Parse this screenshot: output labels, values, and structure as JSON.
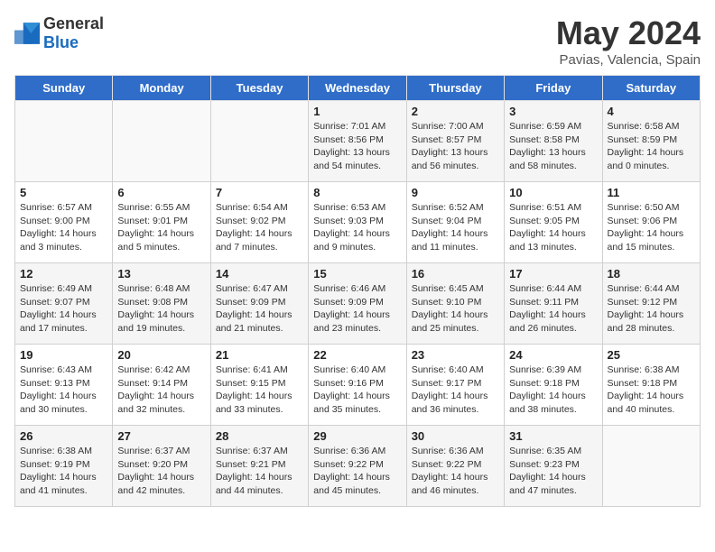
{
  "header": {
    "logo_general": "General",
    "logo_blue": "Blue",
    "title": "May 2024",
    "subtitle": "Pavias, Valencia, Spain"
  },
  "weekdays": [
    "Sunday",
    "Monday",
    "Tuesday",
    "Wednesday",
    "Thursday",
    "Friday",
    "Saturday"
  ],
  "weeks": [
    [
      {
        "day": "",
        "info": ""
      },
      {
        "day": "",
        "info": ""
      },
      {
        "day": "",
        "info": ""
      },
      {
        "day": "1",
        "info": "Sunrise: 7:01 AM\nSunset: 8:56 PM\nDaylight: 13 hours\nand 54 minutes."
      },
      {
        "day": "2",
        "info": "Sunrise: 7:00 AM\nSunset: 8:57 PM\nDaylight: 13 hours\nand 56 minutes."
      },
      {
        "day": "3",
        "info": "Sunrise: 6:59 AM\nSunset: 8:58 PM\nDaylight: 13 hours\nand 58 minutes."
      },
      {
        "day": "4",
        "info": "Sunrise: 6:58 AM\nSunset: 8:59 PM\nDaylight: 14 hours\nand 0 minutes."
      }
    ],
    [
      {
        "day": "5",
        "info": "Sunrise: 6:57 AM\nSunset: 9:00 PM\nDaylight: 14 hours\nand 3 minutes."
      },
      {
        "day": "6",
        "info": "Sunrise: 6:55 AM\nSunset: 9:01 PM\nDaylight: 14 hours\nand 5 minutes."
      },
      {
        "day": "7",
        "info": "Sunrise: 6:54 AM\nSunset: 9:02 PM\nDaylight: 14 hours\nand 7 minutes."
      },
      {
        "day": "8",
        "info": "Sunrise: 6:53 AM\nSunset: 9:03 PM\nDaylight: 14 hours\nand 9 minutes."
      },
      {
        "day": "9",
        "info": "Sunrise: 6:52 AM\nSunset: 9:04 PM\nDaylight: 14 hours\nand 11 minutes."
      },
      {
        "day": "10",
        "info": "Sunrise: 6:51 AM\nSunset: 9:05 PM\nDaylight: 14 hours\nand 13 minutes."
      },
      {
        "day": "11",
        "info": "Sunrise: 6:50 AM\nSunset: 9:06 PM\nDaylight: 14 hours\nand 15 minutes."
      }
    ],
    [
      {
        "day": "12",
        "info": "Sunrise: 6:49 AM\nSunset: 9:07 PM\nDaylight: 14 hours\nand 17 minutes."
      },
      {
        "day": "13",
        "info": "Sunrise: 6:48 AM\nSunset: 9:08 PM\nDaylight: 14 hours\nand 19 minutes."
      },
      {
        "day": "14",
        "info": "Sunrise: 6:47 AM\nSunset: 9:09 PM\nDaylight: 14 hours\nand 21 minutes."
      },
      {
        "day": "15",
        "info": "Sunrise: 6:46 AM\nSunset: 9:09 PM\nDaylight: 14 hours\nand 23 minutes."
      },
      {
        "day": "16",
        "info": "Sunrise: 6:45 AM\nSunset: 9:10 PM\nDaylight: 14 hours\nand 25 minutes."
      },
      {
        "day": "17",
        "info": "Sunrise: 6:44 AM\nSunset: 9:11 PM\nDaylight: 14 hours\nand 26 minutes."
      },
      {
        "day": "18",
        "info": "Sunrise: 6:44 AM\nSunset: 9:12 PM\nDaylight: 14 hours\nand 28 minutes."
      }
    ],
    [
      {
        "day": "19",
        "info": "Sunrise: 6:43 AM\nSunset: 9:13 PM\nDaylight: 14 hours\nand 30 minutes."
      },
      {
        "day": "20",
        "info": "Sunrise: 6:42 AM\nSunset: 9:14 PM\nDaylight: 14 hours\nand 32 minutes."
      },
      {
        "day": "21",
        "info": "Sunrise: 6:41 AM\nSunset: 9:15 PM\nDaylight: 14 hours\nand 33 minutes."
      },
      {
        "day": "22",
        "info": "Sunrise: 6:40 AM\nSunset: 9:16 PM\nDaylight: 14 hours\nand 35 minutes."
      },
      {
        "day": "23",
        "info": "Sunrise: 6:40 AM\nSunset: 9:17 PM\nDaylight: 14 hours\nand 36 minutes."
      },
      {
        "day": "24",
        "info": "Sunrise: 6:39 AM\nSunset: 9:18 PM\nDaylight: 14 hours\nand 38 minutes."
      },
      {
        "day": "25",
        "info": "Sunrise: 6:38 AM\nSunset: 9:18 PM\nDaylight: 14 hours\nand 40 minutes."
      }
    ],
    [
      {
        "day": "26",
        "info": "Sunrise: 6:38 AM\nSunset: 9:19 PM\nDaylight: 14 hours\nand 41 minutes."
      },
      {
        "day": "27",
        "info": "Sunrise: 6:37 AM\nSunset: 9:20 PM\nDaylight: 14 hours\nand 42 minutes."
      },
      {
        "day": "28",
        "info": "Sunrise: 6:37 AM\nSunset: 9:21 PM\nDaylight: 14 hours\nand 44 minutes."
      },
      {
        "day": "29",
        "info": "Sunrise: 6:36 AM\nSunset: 9:22 PM\nDaylight: 14 hours\nand 45 minutes."
      },
      {
        "day": "30",
        "info": "Sunrise: 6:36 AM\nSunset: 9:22 PM\nDaylight: 14 hours\nand 46 minutes."
      },
      {
        "day": "31",
        "info": "Sunrise: 6:35 AM\nSunset: 9:23 PM\nDaylight: 14 hours\nand 47 minutes."
      },
      {
        "day": "",
        "info": ""
      }
    ]
  ]
}
